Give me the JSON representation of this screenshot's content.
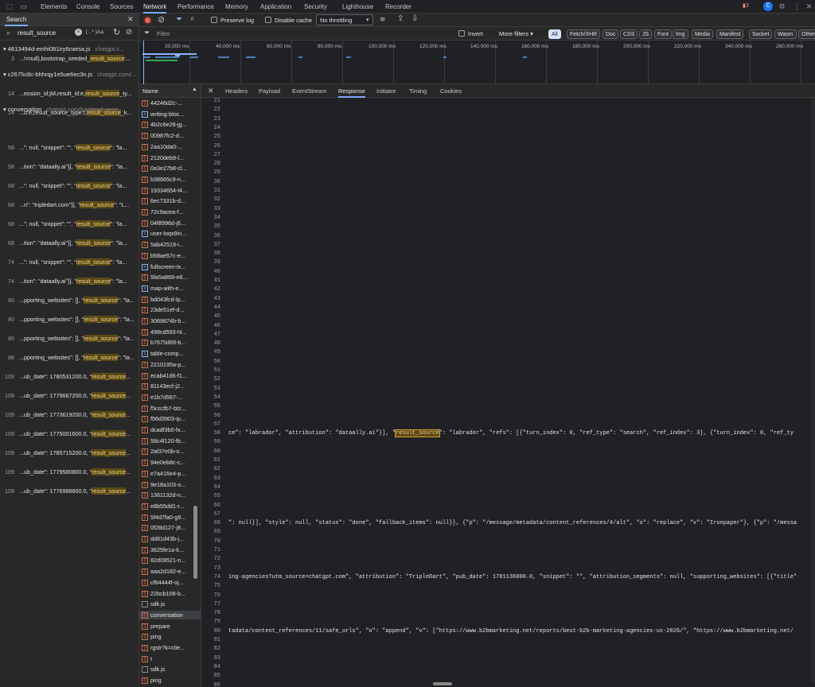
{
  "top_tabs": [
    "Elements",
    "Console",
    "Sources",
    "Network",
    "Performance",
    "Memory",
    "Application",
    "Security",
    "Lighthouse",
    "Recorder"
  ],
  "active_tab": "Network",
  "issues_count": "3",
  "drawer": {
    "title": "Search",
    "query": "result_source",
    "regex_label": "(.*)",
    "case_label": "Aa",
    "groups": [
      {
        "file": "4813494d-emhi081iry6cwrsa.js",
        "url": "chatgpt.c...",
        "lines": [
          {
            "n": "3",
            "pre": "...!=null),bootstrap_seeded_",
            "hit": "result_source",
            "post": ":..."
          }
        ]
      },
      {
        "file": "c2675c8c-bhhrqy1e5ue6ec3n.js",
        "url": "chatgpt.com/...",
        "lines": [
          {
            "n": "14",
            "pre": "...ession_id;jM,result_id:e,",
            "hit": "result_source",
            "post": "_ty..."
          },
          {
            "n": "14",
            "pre": "...d:e,result_source_type:t,",
            "hit": "result_source",
            "post": "_k..."
          }
        ]
      },
      {
        "file": "conversation",
        "url": "chatgpt.com/backend-anon...",
        "lines": [
          {
            "n": "58",
            "pre": "...\": null, \"snippet\": \"\", \"",
            "hit": "result_source",
            "post": "\": \"la..."
          },
          {
            "n": "58",
            "pre": "...tion\": \"dataally.ai\"}], \"",
            "hit": "result_source",
            "post": "\": \"la..."
          },
          {
            "n": "68",
            "pre": "...\": null, \"snippet\": \"\", \"",
            "hit": "result_source",
            "post": "\": \"la..."
          },
          {
            "n": "68",
            "pre": "...n\": \"tripledart.com\"}], \"",
            "hit": "result_source",
            "post": "\": \"L..."
          },
          {
            "n": "68",
            "pre": "...\": null, \"snippet\": \"\", \"",
            "hit": "result_source",
            "post": "\": \"la..."
          },
          {
            "n": "68",
            "pre": "...tion\": \"dataally.ai\"}], \"",
            "hit": "result_source",
            "post": "\": \"la..."
          },
          {
            "n": "74",
            "pre": "...\": null, \"snippet\": \"\", \"",
            "hit": "result_source",
            "post": "\": \"la..."
          },
          {
            "n": "74",
            "pre": "...tion\": \"dataally.ai\"}], \"",
            "hit": "result_source",
            "post": "\": \"la..."
          },
          {
            "n": "80",
            "pre": "...pporting_websites\": [], \"",
            "hit": "result_source",
            "post": "\": \"la..."
          },
          {
            "n": "80",
            "pre": "...pporting_websites\": [], \"",
            "hit": "result_source",
            "post": "\": \"la..."
          },
          {
            "n": "80",
            "pre": "...pporting_websites\": [], \"",
            "hit": "result_source",
            "post": "\": \"la..."
          },
          {
            "n": "88",
            "pre": "...pporting_websites\": [], \"",
            "hit": "result_source",
            "post": "\": \"la..."
          },
          {
            "n": "109",
            "pre": "...ub_date\": 1780531200.0, \"",
            "hit": "result_source",
            "post": "..."
          },
          {
            "n": "109",
            "pre": "...ub_date\": 1779667200.0, \"",
            "hit": "result_source",
            "post": "..."
          },
          {
            "n": "109",
            "pre": "...ub_date\": 1773619200.0, \"",
            "hit": "result_source",
            "post": "..."
          },
          {
            "n": "109",
            "pre": "...ub_date\": 1775001600.0, \"",
            "hit": "result_source",
            "post": "..."
          },
          {
            "n": "109",
            "pre": "...ub_date\": 1785715200.0, \"",
            "hit": "result_source",
            "post": "..."
          },
          {
            "n": "109",
            "pre": "...ub_date\": 1779580800.0, \"",
            "hit": "result_source",
            "post": "..."
          },
          {
            "n": "109",
            "pre": "...ub_date\": 1776988800.0, \"",
            "hit": "result_source",
            "post": "..."
          }
        ]
      }
    ]
  },
  "toolbar": {
    "preserve_log": "Preserve log",
    "disable_cache": "Disable cache",
    "throttling": "No throttling"
  },
  "filterbar": {
    "placeholder": "Filter",
    "invert": "Invert",
    "more_filters": "More filters",
    "types": [
      "All",
      "Fetch/XHR",
      "Doc",
      "CSS",
      "JS",
      "Font",
      "Img",
      "Media",
      "Manifest",
      "Socket",
      "Wasm",
      "Other"
    ]
  },
  "timeline_ticks": [
    "20,000 ms",
    "40,000 ms",
    "60,000 ms",
    "80,000 ms",
    "100,000 ms",
    "120,000 ms",
    "140,000 ms",
    "160,000 ms",
    "180,000 ms",
    "200,000 ms",
    "220,000 ms",
    "240,000 ms",
    "260,000 ms"
  ],
  "requests": {
    "header": "Name",
    "items": [
      {
        "name": "44246d2c-...",
        "type": "xhr"
      },
      {
        "name": "writing-bloc...",
        "type": "doc"
      },
      {
        "name": "4b2c6e28-jg...",
        "type": "xhr"
      },
      {
        "name": "00987fc2-d...",
        "type": "xhr"
      },
      {
        "name": "2aa10da0-...",
        "type": "xhr"
      },
      {
        "name": "2120deb9-l...",
        "type": "xhr"
      },
      {
        "name": "0a3e27b8-cl...",
        "type": "xhr"
      },
      {
        "name": "b38665c9-n...",
        "type": "xhr"
      },
      {
        "name": "19334654-l4...",
        "type": "xhr"
      },
      {
        "name": "6ec7331b-d...",
        "type": "xhr"
      },
      {
        "name": "72c9acea-f...",
        "type": "xhr"
      },
      {
        "name": "04f8996d-j6...",
        "type": "xhr"
      },
      {
        "name": "user-loqx9in...",
        "type": "doc"
      },
      {
        "name": "5ab42519-i...",
        "type": "xhr"
      },
      {
        "name": "b58ae57c-e...",
        "type": "xhr"
      },
      {
        "name": "fullscreen-lx...",
        "type": "doc"
      },
      {
        "name": "5fa5a869-e8...",
        "type": "xhr"
      },
      {
        "name": "map-with-e...",
        "type": "doc"
      },
      {
        "name": "bd043fcd-lp...",
        "type": "xhr"
      },
      {
        "name": "23de51ef-d...",
        "type": "xhr"
      },
      {
        "name": "3069874b-b...",
        "type": "xhr"
      },
      {
        "name": "498cd593-hl...",
        "type": "xhr"
      },
      {
        "name": "b7675d69-b...",
        "type": "xhr"
      },
      {
        "name": "table-comp...",
        "type": "doc"
      },
      {
        "name": "2210195a-p...",
        "type": "xhr"
      },
      {
        "name": "ecab41d6-f1...",
        "type": "xhr"
      },
      {
        "name": "81143ecf-j2...",
        "type": "xhr"
      },
      {
        "name": "e1b7d567-...",
        "type": "xhr"
      },
      {
        "name": "f5cccfb7-btz...",
        "type": "xhr"
      },
      {
        "name": "f56d3903-ip...",
        "type": "xhr"
      },
      {
        "name": "dcadf3b0-fx...",
        "type": "xhr"
      },
      {
        "name": "58c4f120-fb...",
        "type": "xhr"
      },
      {
        "name": "2af37e0b-o...",
        "type": "xhr"
      },
      {
        "name": "94e0eb8c-c...",
        "type": "xhr"
      },
      {
        "name": "e7a416e4-p...",
        "type": "xhr"
      },
      {
        "name": "9e18a103-o...",
        "type": "xhr"
      },
      {
        "name": "1361132d-n...",
        "type": "xhr"
      },
      {
        "name": "e8b55dd1-r...",
        "type": "xhr"
      },
      {
        "name": "5f4d7fa0-g9...",
        "type": "xhr"
      },
      {
        "name": "0f28d127-j8...",
        "type": "xhr"
      },
      {
        "name": "dd81d43b-j...",
        "type": "xhr"
      },
      {
        "name": "3625fe1a-k...",
        "type": "xhr"
      },
      {
        "name": "82d09521-n...",
        "type": "xhr"
      },
      {
        "name": "aaa2d182-e...",
        "type": "xhr"
      },
      {
        "name": "cf64444f-oj...",
        "type": "xhr"
      },
      {
        "name": "22bcb108-b...",
        "type": "xhr"
      },
      {
        "name": "sdk.js",
        "type": "js"
      },
      {
        "name": "conversation",
        "type": "xhr"
      },
      {
        "name": "prepare",
        "type": "xhr"
      },
      {
        "name": "ping",
        "type": "xhr"
      },
      {
        "name": "rgstr?k=clie...",
        "type": "xhr"
      },
      {
        "name": "t",
        "type": "xhr"
      },
      {
        "name": "sdk.js",
        "type": "js"
      },
      {
        "name": "ping",
        "type": "xhr"
      }
    ],
    "selected": "conversation"
  },
  "response_tabs": [
    "Headers",
    "Payload",
    "EventStream",
    "Response",
    "Initiator",
    "Timing",
    "Cookies"
  ],
  "active_response_tab": "Response",
  "code": {
    "first_line": 21,
    "last_line": 87,
    "lines": {
      "58": {
        "pre": "ce\": \"labrador\", \"attribution\": \"dataally.ai\"}], \"",
        "hit": "result_source",
        "post": "\": \"labrador\", \"refs\": [{\"turn_index\": 0, \"ref_type\": \"search\", \"ref_index\": 3}, {\"turn_index\": 0, \"ref_ty"
      },
      "68": {
        "pre": "\": null}], \"style\": null, \"status\": \"done\", \"fallback_items\": null}}, {\"p\": \"/message/metadata/content_references/4/alt\", \"o\": \"replace\", \"v\": \"Ironpaper\"}, {\"p\": \"/messa",
        "hit": "",
        "post": ""
      },
      "74": {
        "pre": "ing-agencies?utm_source=chatgpt.com\", \"attribution\": \"TripleDart\", \"pub_date\": 1781136000.0, \"snippet\": \"\", \"attribution_segments\": null, \"supporting_websites\": [{\"title\"",
        "hit": "",
        "post": ""
      },
      "80": {
        "pre": "tadata/content_references/11/safe_urls\", \"o\": \"append\", \"v\": [\"https://www.b2bmarketing.net/reports/best-b2b-marketing-agencies-us-2026/\", \"https://www.b2bmarketing.net/",
        "hit": "",
        "post": ""
      }
    }
  },
  "colors": {
    "accent": "#7cacf8",
    "highlight": "#5b4a16",
    "record": "#e46962"
  }
}
